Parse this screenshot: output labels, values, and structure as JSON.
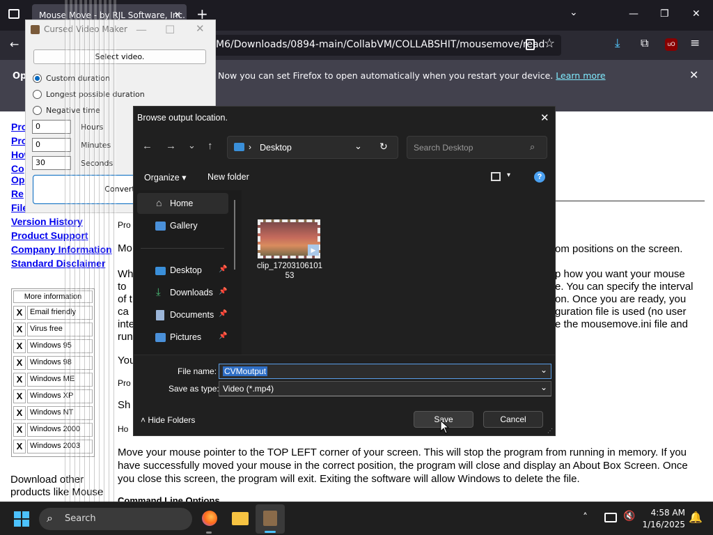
{
  "browser": {
    "tab_title": "Mouse Move - by RJL Software, Inc.",
    "url": "M6/Downloads/0894-main/CollabVM/COLLABSHIT/mousemove/read",
    "notice": "Now you can set Firefox to open automatically when you restart your device.",
    "notice_link": "Learn more",
    "notice_prefix": "Op"
  },
  "page": {
    "links": [
      "Pro",
      "Pro",
      "How",
      "Co",
      "Op",
      "Re",
      "File",
      "Version History",
      "Product Support",
      "Company Information",
      "Standard Disclaimer"
    ],
    "features_header": "More information",
    "features": [
      "Email friendly",
      "Virus free",
      "Windows 95",
      "Windows 98",
      "Windows ME",
      "Windows XP",
      "Windows NT",
      "Windows 2000",
      "Windows 2003"
    ],
    "x_mark": "X",
    "download_text": "Download other products like Mouse",
    "right_fragments": [
      "om positions on the screen.",
      "p how you want your mouse",
      "e. You can specify the interval",
      "on. Once you are ready, you",
      "guration file is used (no user",
      "e the mousemove.ini file and"
    ],
    "left_fragments": [
      "Pro",
      "Mo",
      "Wh",
      "to",
      "of t",
      "ca",
      "inte",
      "run",
      "You",
      "Pro",
      "Sh",
      "Ho"
    ],
    "para": "Move your mouse pointer to the TOP LEFT corner of your screen. This will stop the program from running in memory. If you have successfully moved your mouse in the correct position, the program will close and display an About Box Screen. Once you close this screen, the program will exit. Exiting the software will allow Windows to delete the file.",
    "cmd_heading": "Command Line Options"
  },
  "cvm": {
    "title": "Cursed Video Maker",
    "select_label": "Select video.",
    "opt_custom": "Custom duration",
    "opt_longest": "Longest possible duration",
    "opt_negative": "Negative time",
    "hours_val": "0",
    "hours_label": "Hours",
    "minutes_val": "0",
    "minutes_label": "Minutes",
    "seconds_val": "30",
    "seconds_label": "Seconds",
    "convert_label": "Convert"
  },
  "dialog": {
    "title": "Browse output location.",
    "location": "Desktop",
    "search_placeholder": "Search Desktop",
    "organize": "Organize",
    "new_folder": "New folder",
    "nav": [
      "Home",
      "Gallery",
      "Desktop",
      "Downloads",
      "Documents",
      "Pictures"
    ],
    "file_name": "clip_17203106101\n53",
    "file_name_label": "File name:",
    "file_name_value": "CVMoutput",
    "type_label": "Save as type:",
    "type_value": "Video (*.mp4)",
    "hide_folders": "Hide Folders",
    "save": "Save",
    "cancel": "Cancel"
  },
  "taskbar": {
    "search": "Search",
    "time": "4:58 AM",
    "date": "1/16/2025"
  }
}
